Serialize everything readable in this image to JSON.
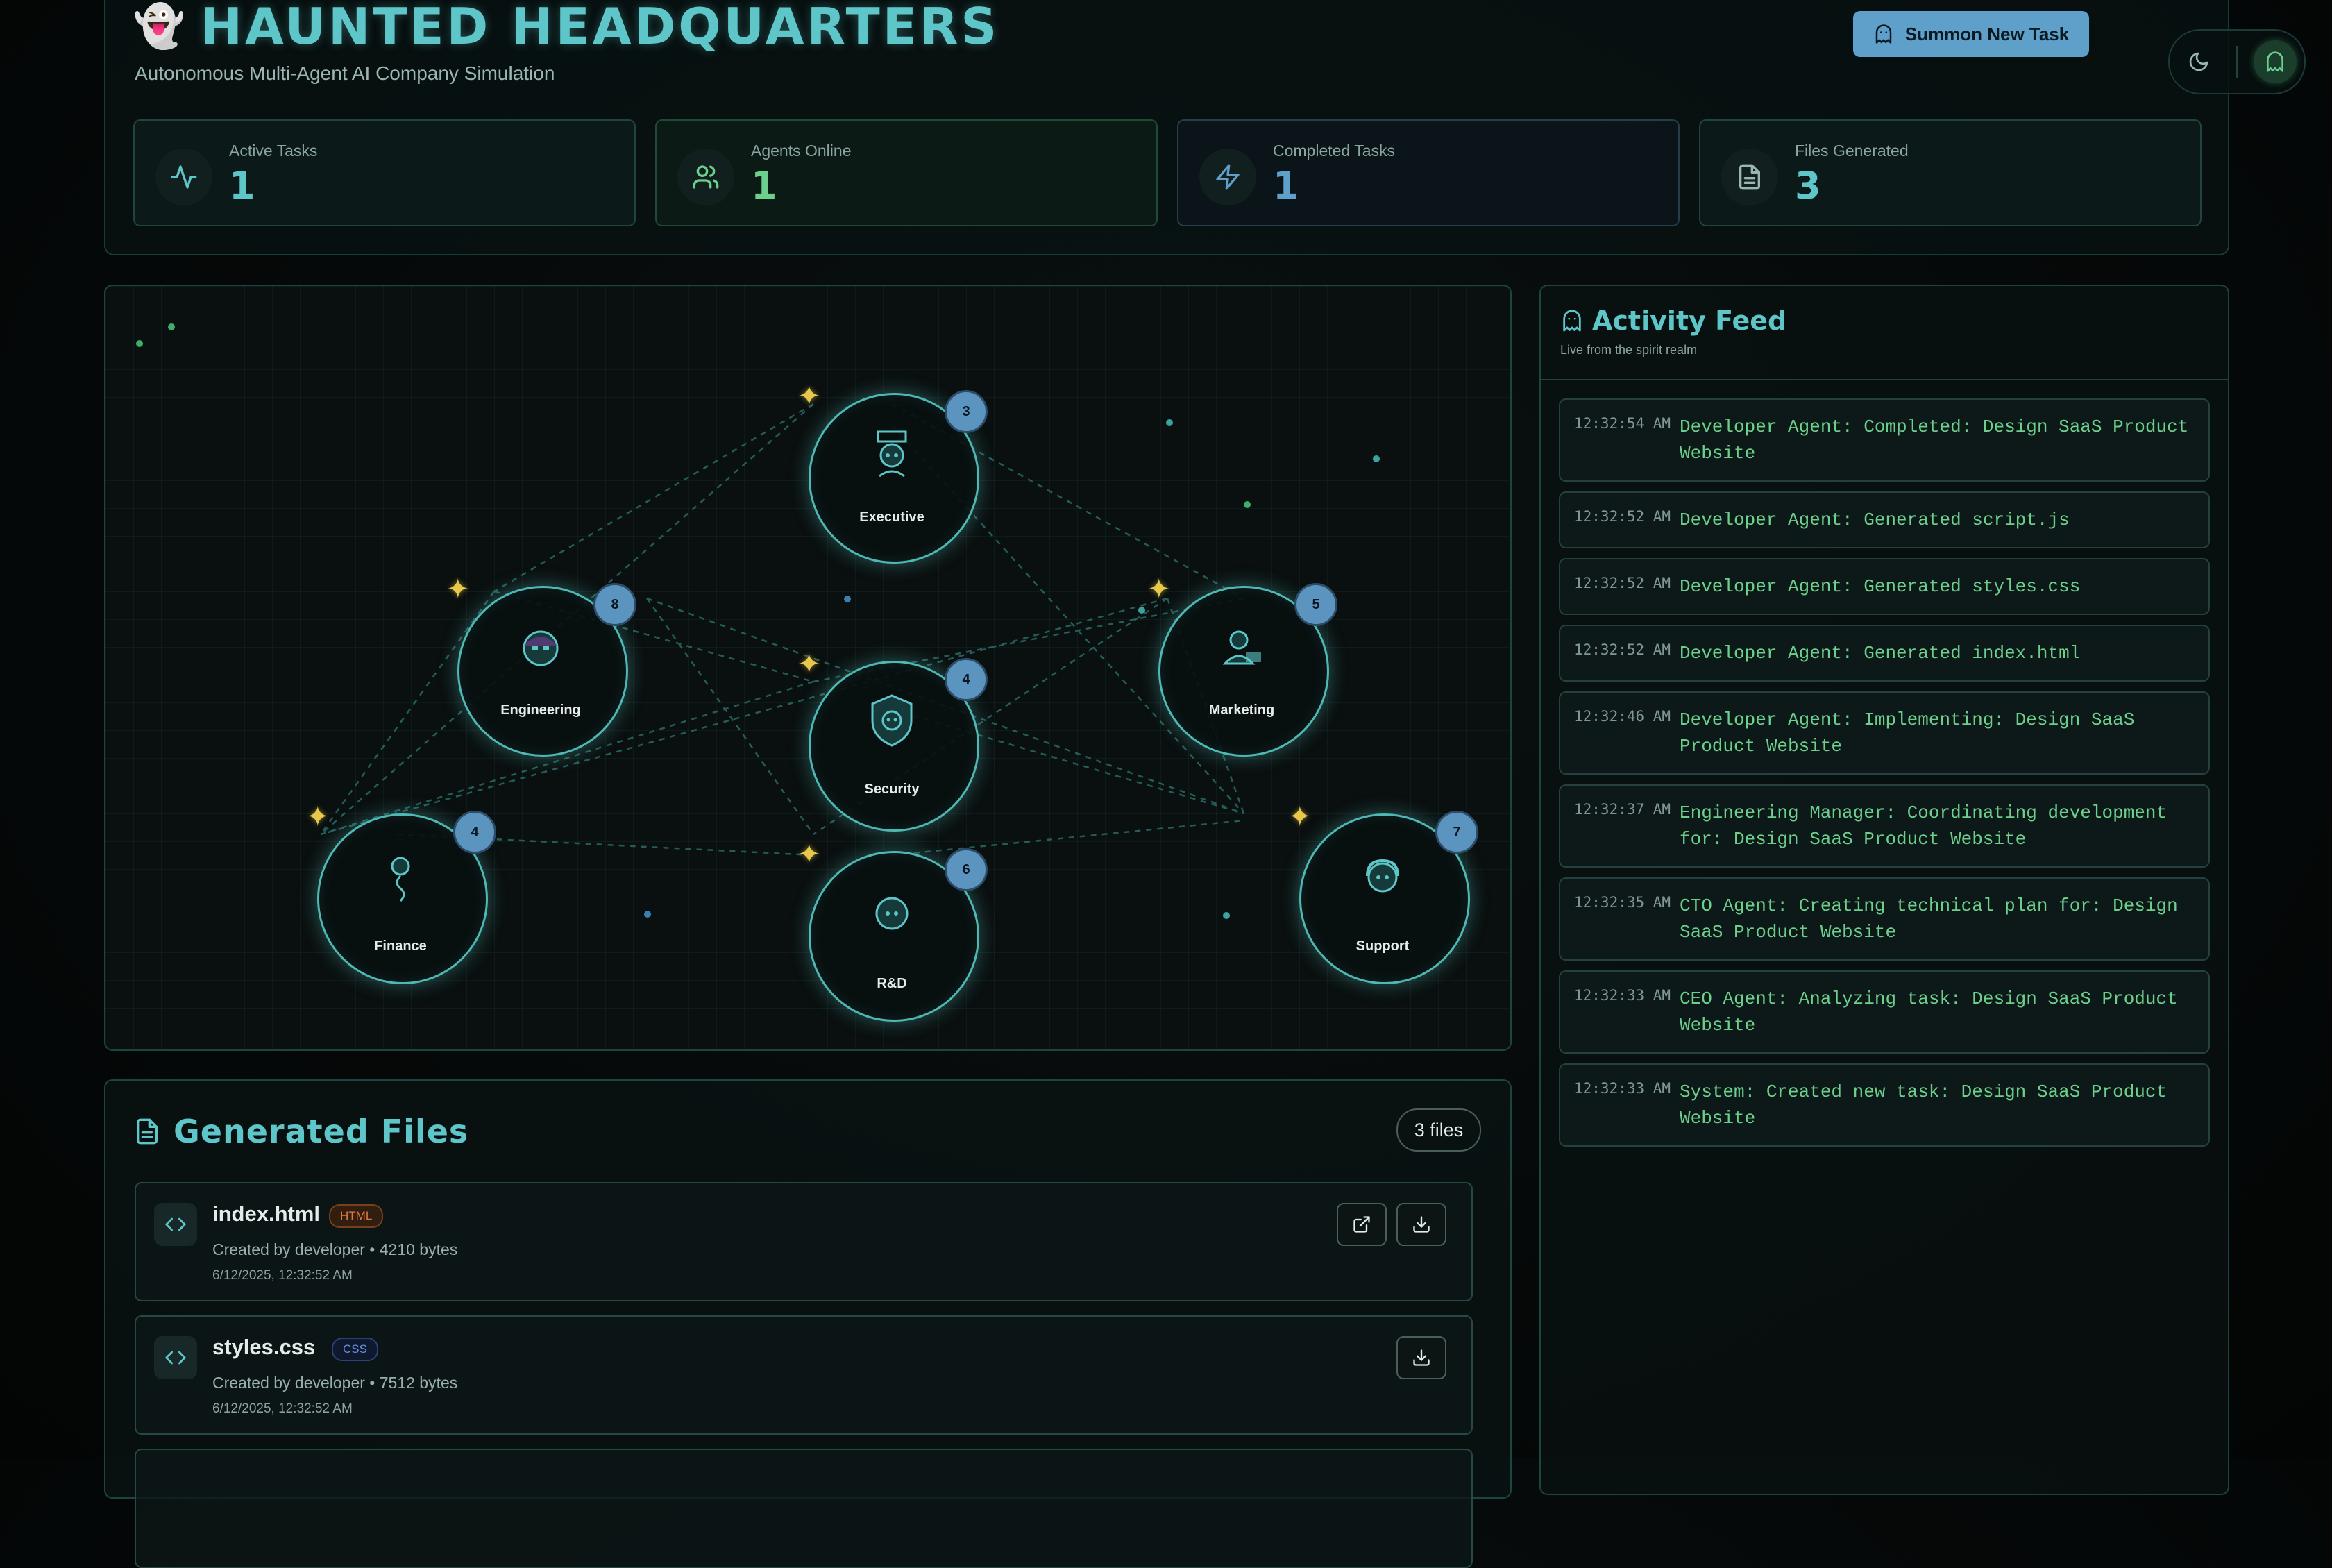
{
  "header": {
    "emoji": "👻",
    "title": "HAUNTED HEADQUARTERS",
    "subtitle": "Autonomous Multi-Agent AI Company Simulation",
    "summon_label": "Summon New Task"
  },
  "stats": [
    {
      "label": "Active Tasks",
      "value": "1",
      "icon": "activity-icon",
      "color": "#5ec6c8"
    },
    {
      "label": "Agents Online",
      "value": "1",
      "icon": "users-icon",
      "color": "#6cd08c"
    },
    {
      "label": "Completed Tasks",
      "value": "1",
      "icon": "zap-icon",
      "color": "#5ea0c9"
    },
    {
      "label": "Files Generated",
      "value": "3",
      "icon": "file-icon",
      "color": "#5ec6c8"
    }
  ],
  "departments": [
    {
      "name": "Executive",
      "count": "3"
    },
    {
      "name": "Engineering",
      "count": "8"
    },
    {
      "name": "Marketing",
      "count": "5"
    },
    {
      "name": "Security",
      "count": "4"
    },
    {
      "name": "Finance",
      "count": "4"
    },
    {
      "name": "R&D",
      "count": "6"
    },
    {
      "name": "Support",
      "count": "7"
    }
  ],
  "files": {
    "title": "Generated Files",
    "count_label": "3 files",
    "items": [
      {
        "name": "index.html",
        "tag": "HTML",
        "meta": "Created by developer • 4210 bytes",
        "date": "6/12/2025, 12:32:52 AM"
      },
      {
        "name": "styles.css",
        "tag": "CSS",
        "meta": "Created by developer • 7512 bytes",
        "date": "6/12/2025, 12:32:52 AM"
      }
    ]
  },
  "feed": {
    "title": "Activity Feed",
    "subtitle": "Live from the spirit realm",
    "items": [
      {
        "time": "12:32:54 AM",
        "text": "Developer Agent: Completed: Design SaaS Product Website"
      },
      {
        "time": "12:32:52 AM",
        "text": "Developer Agent: Generated script.js"
      },
      {
        "time": "12:32:52 AM",
        "text": "Developer Agent: Generated styles.css"
      },
      {
        "time": "12:32:52 AM",
        "text": "Developer Agent: Generated index.html"
      },
      {
        "time": "12:32:46 AM",
        "text": "Developer Agent: Implementing: Design SaaS Product Website"
      },
      {
        "time": "12:32:37 AM",
        "text": "Engineering Manager: Coordinating development for: Design SaaS Product Website"
      },
      {
        "time": "12:32:35 AM",
        "text": "CTO Agent: Creating technical plan for: Design SaaS Product Website"
      },
      {
        "time": "12:32:33 AM",
        "text": "CEO Agent: Analyzing task: Design SaaS Product Website"
      },
      {
        "time": "12:32:33 AM",
        "text": "System: Created new task: Design SaaS Product Website"
      }
    ]
  },
  "colors": {
    "accent": "#5ec6c8",
    "feed_text": "#6cd08c",
    "badge": "#5a94bf",
    "button": "#5ea0c9"
  }
}
